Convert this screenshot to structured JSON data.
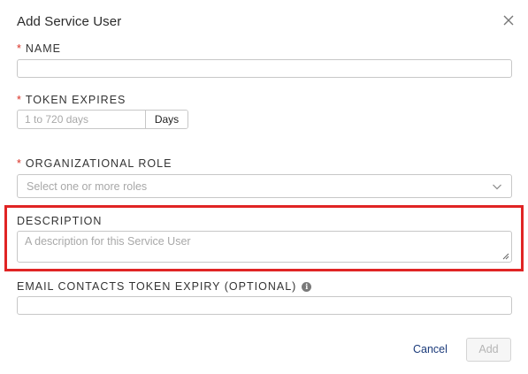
{
  "dialog": {
    "title": "Add Service User",
    "close_icon": "close-icon"
  },
  "form": {
    "required_marker": "*",
    "name": {
      "label": "NAME",
      "value": ""
    },
    "token_expires": {
      "label": "TOKEN EXPIRES",
      "placeholder": "1 to 720 days",
      "unit_label": "Days"
    },
    "organizational_role": {
      "label": "ORGANIZATIONAL ROLE",
      "placeholder": "Select one or more roles",
      "chevron_icon": "chevron-down-icon"
    },
    "description": {
      "label": "DESCRIPTION",
      "placeholder": "A description for this Service User"
    },
    "email_contacts": {
      "label": "EMAIL CONTACTS TOKEN EXPIRY (OPTIONAL)",
      "info_icon": "info-icon",
      "info_glyph": "i",
      "value": ""
    }
  },
  "actions": {
    "cancel_label": "Cancel",
    "add_label": "Add"
  },
  "colors": {
    "required": "#d93025",
    "highlight": "#e02424",
    "link": "#1a3a7a"
  }
}
